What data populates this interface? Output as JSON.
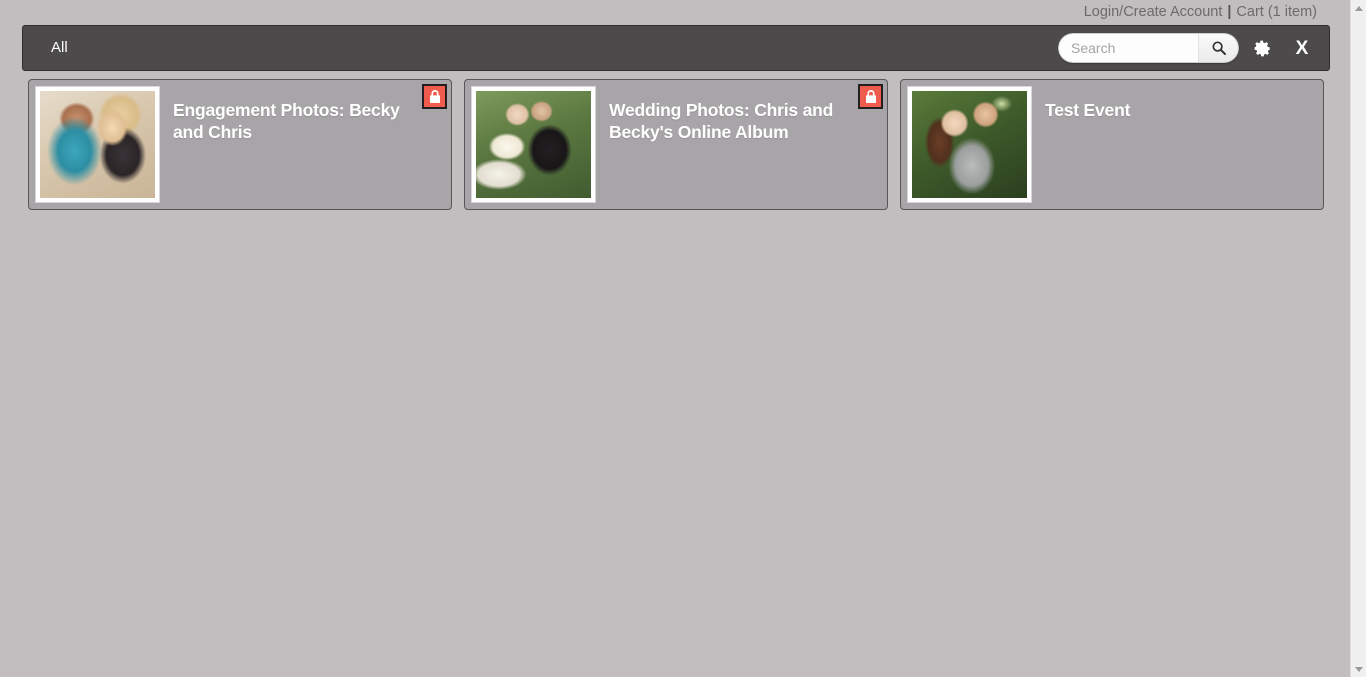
{
  "topbar": {
    "login_label": "Login/Create Account",
    "separator": "|",
    "cart_label": "Cart (1 item)"
  },
  "navbar": {
    "all_label": "All",
    "search": {
      "placeholder": "Search",
      "value": "",
      "button_icon": "search-icon"
    },
    "settings_icon": "gear-icon",
    "close_label": "X"
  },
  "cards": [
    {
      "title": "Engagement Photos: Becky and Chris",
      "thumb_class": "img-engagement",
      "locked": true,
      "lock_icon": "lock-icon"
    },
    {
      "title": "Wedding Photos: Chris and Becky's Online Album",
      "thumb_class": "img-wedding",
      "locked": true,
      "lock_icon": "lock-icon"
    },
    {
      "title": "Test Event",
      "thumb_class": "img-test",
      "locked": false,
      "lock_icon": "lock-icon"
    }
  ],
  "scrollbar": {
    "up_icon": "scroll-up-arrow-icon",
    "down_icon": "scroll-down-arrow-icon"
  },
  "colors": {
    "page_background": "#c2bec0",
    "navbar_background": "#4c4a4a",
    "card_background": "#a8a5a8",
    "card_border": "#585658",
    "lock_badge": "#ef5b4c",
    "title_text": "#ffffff",
    "toplink_text": "#6c6a6c"
  }
}
